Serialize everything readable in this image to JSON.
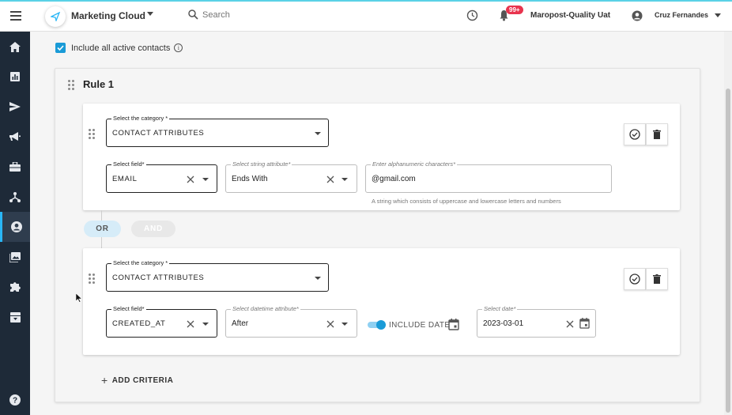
{
  "header": {
    "app_name": "Marketing Cloud",
    "search_placeholder": "Search",
    "notification_badge": "99+",
    "org_name": "Maropost-Quality Uat",
    "user_name": "Cruz Fernandes"
  },
  "sidebar": {
    "items": [
      {
        "icon": "home-icon"
      },
      {
        "icon": "reports-icon"
      },
      {
        "icon": "send-icon"
      },
      {
        "icon": "megaphone-icon"
      },
      {
        "icon": "briefcase-icon"
      },
      {
        "icon": "journey-icon"
      },
      {
        "icon": "contacts-icon",
        "active": true
      },
      {
        "icon": "images-icon"
      },
      {
        "icon": "puzzle-icon"
      },
      {
        "icon": "archive-icon"
      },
      {
        "icon": "help-icon"
      }
    ]
  },
  "main": {
    "include_all_label": "Include all active contacts",
    "include_all_checked": true,
    "rule_title": "Rule 1",
    "criteria": [
      {
        "category_label": "Select the category *",
        "category_value": "CONTACT ATTRIBUTES",
        "field_label": "Select field*",
        "field_value": "EMAIL",
        "attribute_label": "Select string attribute*",
        "attribute_value": "Ends With",
        "input_label": "Enter alphanumeric characters*",
        "input_value": "@gmail.com",
        "helper_text": "A string which consists of uppercase and lowercase letters and numbers"
      },
      {
        "category_label": "Select the category *",
        "category_value": "CONTACT ATTRIBUTES",
        "field_label": "Select field*",
        "field_value": "CREATED_AT",
        "attribute_label": "Select datetime attribute*",
        "attribute_value": "After",
        "include_date_label": "INCLUDE DATE",
        "include_date_on": true,
        "date_label": "Select date*",
        "date_value": "2023-03-01"
      }
    ],
    "or_label": "OR",
    "and_label": "AND",
    "add_criteria_label": "ADD CRITERIA"
  },
  "colors": {
    "accent": "#1a9bd7",
    "sidebar_bg": "#1e2a38",
    "badge": "#e8344e"
  }
}
